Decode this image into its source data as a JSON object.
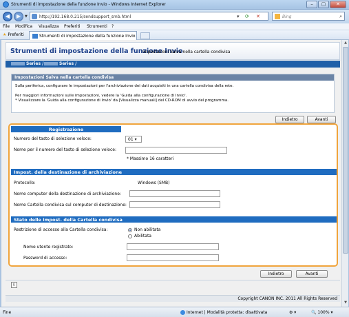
{
  "window": {
    "title": "Strumenti di impostazione della funzione Invio - Windows Internet Explorer",
    "controls": {
      "minimize": "–",
      "maximize": "▢",
      "close": "✕"
    }
  },
  "browser": {
    "url": "http://192.168.0.215/sendsupport_smb.html",
    "search_placeholder": "Bing",
    "menu": [
      "File",
      "Modifica",
      "Visualizza",
      "Preferiti",
      "Strumenti",
      "?"
    ],
    "favorites_label": "Preferiti",
    "tab_label": "Strumenti di impostazione della funzione Invio",
    "icons": {
      "back": "back-arrow-icon",
      "forward": "forward-arrow-icon",
      "refresh": "refresh-icon",
      "stop": "stop-icon",
      "search": "search-icon",
      "star": "star-icon"
    }
  },
  "page": {
    "app_title": "Strumenti di impostazione della funzione Invio",
    "app_subtitle": "Impostazioni Salva nella cartella condivisa",
    "series": [
      "Series /",
      "Series /"
    ],
    "info": {
      "header": "Impostazioni Salva nella cartella condivisa",
      "line1": "Sulla periferica, configurare le impostazioni per l'archiviazione dei dati acquisiti in una cartella condivisa della rete.",
      "line2": "Per maggiori informazioni sulle impostazioni, vedere la 'Guida alla configurazione di Invio'.",
      "line3": "* Visualizzare la 'Guida alla configurazione di Invio' da [Visualizza manuali] del CD-ROM di avvio del programma."
    },
    "buttons": {
      "back": "Indietro",
      "next": "Avanti"
    },
    "registration": {
      "header": "Registrazione",
      "speed_dial_label": "Numero del tasto di selezione veloce:",
      "speed_dial_value": "01",
      "name_label": "Nome per il numero del tasto di selezione veloce:",
      "name_value": "",
      "name_hint": "* Massimo 16 caratteri"
    },
    "destination": {
      "header": "Impost. della destinazione di archiviazione",
      "protocol_label": "Protocollo:",
      "protocol_value": "Windows (SMB)",
      "computer_label": "Nome computer della destinazione di archiviazione:",
      "computer_value": "",
      "folder_label": "Nome Cartella condivisa sul computer di destinazione:",
      "folder_value": ""
    },
    "access": {
      "header": "Stato delle Impost. della Cartella condivisa",
      "restriction_label": "Restrizione di accesso alla Cartella condivisa:",
      "option_disabled": "Non abilitata",
      "option_enabled": "Abilitata",
      "selected": "Non abilitata",
      "username_label": "Nome utente registrato:",
      "username_value": "",
      "password_label": "Password di accesso:",
      "password_value": ""
    },
    "footer": "Copyright CANON INC. 2011 All Rights Reserved"
  },
  "status": {
    "left": "Fine",
    "zone": "Internet | Modalità protetta: disattivata",
    "zoom": "100%"
  }
}
